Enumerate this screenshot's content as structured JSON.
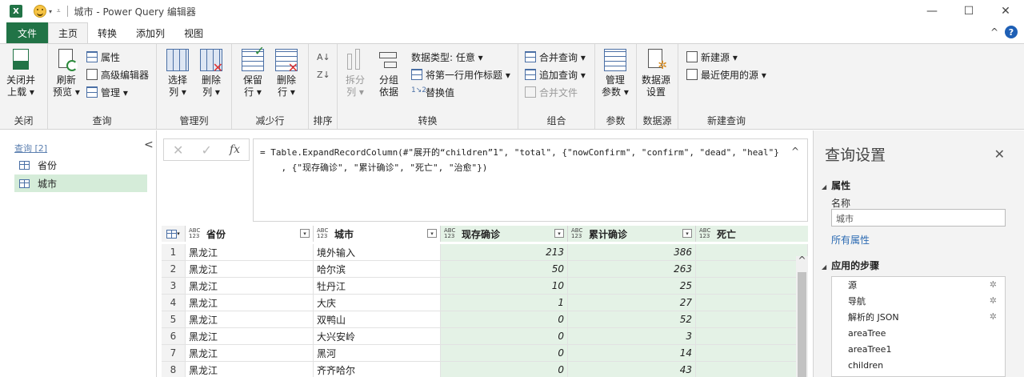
{
  "titlebar": {
    "app_logo": "X",
    "title": "城市 - Power Query 编辑器",
    "minimize": "—",
    "maximize": "☐",
    "close": "✕"
  },
  "tabs": {
    "file": "文件",
    "home": "主页",
    "transform": "转换",
    "add_column": "添加列",
    "view": "视图",
    "collapse_ribbon": "^",
    "help": "?"
  },
  "ribbon": {
    "close_group": {
      "label": "关闭",
      "close_load_line1": "关闭并",
      "close_load_line2": "上载 ▾"
    },
    "query_group": {
      "label": "查询",
      "refresh_line1": "刷新",
      "refresh_line2": "预览 ▾",
      "properties": "属性",
      "advanced_editor": "高级编辑器",
      "manage": "管理 ▾"
    },
    "manage_columns_group": {
      "label": "管理列",
      "choose_line1": "选择",
      "choose_line2": "列 ▾",
      "remove_line1": "删除",
      "remove_line2": "列 ▾"
    },
    "reduce_rows_group": {
      "label": "减少行",
      "keep_line1": "保留",
      "keep_line2": "行 ▾",
      "remove_line1": "删除",
      "remove_line2": "行 ▾"
    },
    "sort_group": {
      "label": "排序"
    },
    "transform_group": {
      "label": "转换",
      "split_line1": "拆分",
      "split_line2": "列 ▾",
      "group_line1": "分组",
      "group_line2": "依据",
      "data_type": "数据类型: 任意 ▾",
      "first_row_header": "将第一行用作标题 ▾",
      "replace_values": "替换值"
    },
    "combine_group": {
      "label": "组合",
      "merge_queries": "合并查询 ▾",
      "append_queries": "追加查询 ▾",
      "combine_files": "合并文件"
    },
    "params_group": {
      "label": "参数",
      "manage_line1": "管理",
      "manage_line2": "参数 ▾"
    },
    "datasource_group": {
      "label": "数据源",
      "settings_line1": "数据源",
      "settings_line2": "设置"
    },
    "new_query_group": {
      "label": "新建查询",
      "new_source": "新建源 ▾",
      "recent_sources": "最近使用的源 ▾"
    }
  },
  "queries": {
    "header": "查询 [2]",
    "collapse": "<",
    "items": [
      {
        "label": "省份",
        "selected": false
      },
      {
        "label": "城市",
        "selected": true
      }
    ]
  },
  "formula_bar": {
    "cancel": "✕",
    "commit": "✓",
    "fx": "fx",
    "line1": "= Table.ExpandRecordColumn(#\"展开的“children”1\", \"total\", {\"nowConfirm\", \"confirm\", \"dead\", \"heal\"}",
    "line2": "    , {\"现存确诊\", \"累计确诊\", \"死亡\", \"治愈\"})",
    "expand": "^"
  },
  "grid": {
    "type_badge_top": "ABC",
    "type_badge_bottom": "123",
    "columns": [
      "省份",
      "城市",
      "现存确诊",
      "累计确诊",
      "死亡"
    ],
    "rows": [
      {
        "n": "1",
        "province": "黑龙江",
        "city": "境外输入",
        "now": "213",
        "total": "386"
      },
      {
        "n": "2",
        "province": "黑龙江",
        "city": "哈尔滨",
        "now": "50",
        "total": "263"
      },
      {
        "n": "3",
        "province": "黑龙江",
        "city": "牡丹江",
        "now": "10",
        "total": "25"
      },
      {
        "n": "4",
        "province": "黑龙江",
        "city": "大庆",
        "now": "1",
        "total": "27"
      },
      {
        "n": "5",
        "province": "黑龙江",
        "city": "双鸭山",
        "now": "0",
        "total": "52"
      },
      {
        "n": "6",
        "province": "黑龙江",
        "city": "大兴安岭",
        "now": "0",
        "total": "3"
      },
      {
        "n": "7",
        "province": "黑龙江",
        "city": "黑河",
        "now": "0",
        "total": "14"
      },
      {
        "n": "8",
        "province": "黑龙江",
        "city": "齐齐哈尔",
        "now": "0",
        "total": "43"
      }
    ]
  },
  "settings": {
    "title": "查询设置",
    "close": "✕",
    "properties_header": "属性",
    "name_label": "名称",
    "name_value": "城市",
    "all_properties": "所有属性",
    "steps_header": "应用的步骤",
    "steps": [
      {
        "label": "源",
        "gear": true
      },
      {
        "label": "导航",
        "gear": true
      },
      {
        "label": "解析的 JSON",
        "gear": true
      },
      {
        "label": "areaTree",
        "gear": false
      },
      {
        "label": "areaTree1",
        "gear": false
      },
      {
        "label": "children",
        "gear": false
      }
    ]
  },
  "colors": {
    "excel_green": "#217346",
    "selected_query": "#d5ecd9",
    "column_highlight": "#e4f2e6",
    "header_accent": "#3cb2a8",
    "link_blue": "#2c6bb3"
  }
}
